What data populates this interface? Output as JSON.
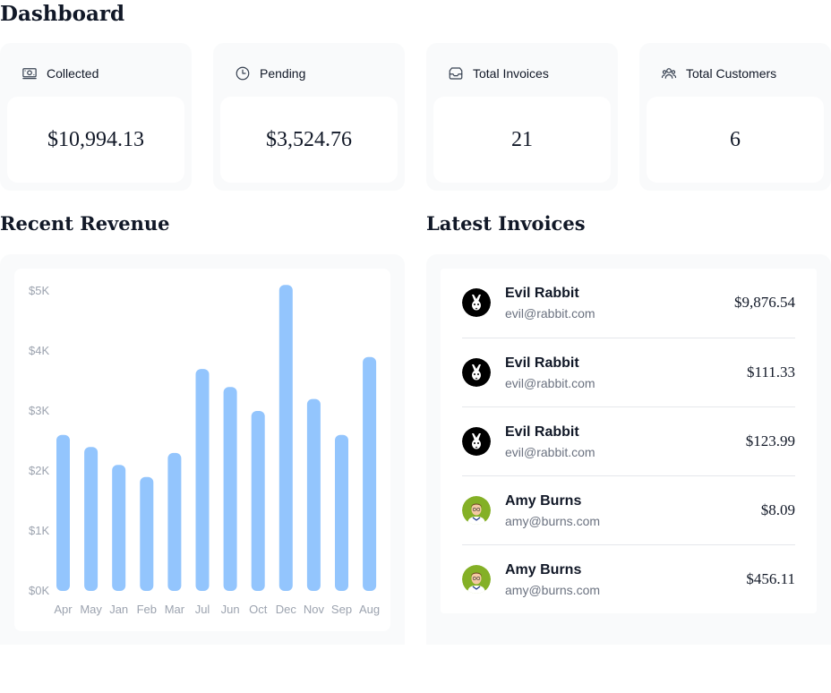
{
  "page": {
    "title": "Dashboard"
  },
  "cards": [
    {
      "label": "Collected",
      "value": "$10,994.13",
      "icon": "banknotes-icon"
    },
    {
      "label": "Pending",
      "value": "$3,524.76",
      "icon": "clock-icon"
    },
    {
      "label": "Total Invoices",
      "value": "21",
      "icon": "inbox-icon"
    },
    {
      "label": "Total Customers",
      "value": "6",
      "icon": "user-group-icon"
    }
  ],
  "revenue": {
    "title": "Recent Revenue"
  },
  "chart_data": {
    "type": "bar",
    "title": "",
    "xlabel": "",
    "ylabel": "",
    "categories": [
      "Apr",
      "May",
      "Jan",
      "Feb",
      "Mar",
      "Jul",
      "Jun",
      "Oct",
      "Dec",
      "Nov",
      "Sep",
      "Aug"
    ],
    "values": [
      2600,
      2400,
      2100,
      1900,
      2300,
      3700,
      3400,
      3000,
      5100,
      3200,
      2600,
      3900
    ],
    "y_ticks": [
      "$0K",
      "$1K",
      "$2K",
      "$3K",
      "$4K",
      "$5K"
    ],
    "ylim": [
      0,
      5000
    ],
    "bar_color": "#93c5fd",
    "grid": false
  },
  "invoices": {
    "title": "Latest Invoices",
    "items": [
      {
        "name": "Evil Rabbit",
        "email": "evil@rabbit.com",
        "amount": "$9,876.54",
        "avatar": "rabbit"
      },
      {
        "name": "Evil Rabbit",
        "email": "evil@rabbit.com",
        "amount": "$111.33",
        "avatar": "rabbit"
      },
      {
        "name": "Evil Rabbit",
        "email": "evil@rabbit.com",
        "amount": "$123.99",
        "avatar": "rabbit"
      },
      {
        "name": "Amy Burns",
        "email": "amy@burns.com",
        "amount": "$8.09",
        "avatar": "amy"
      },
      {
        "name": "Amy Burns",
        "email": "amy@burns.com",
        "amount": "$456.11",
        "avatar": "amy"
      }
    ]
  }
}
